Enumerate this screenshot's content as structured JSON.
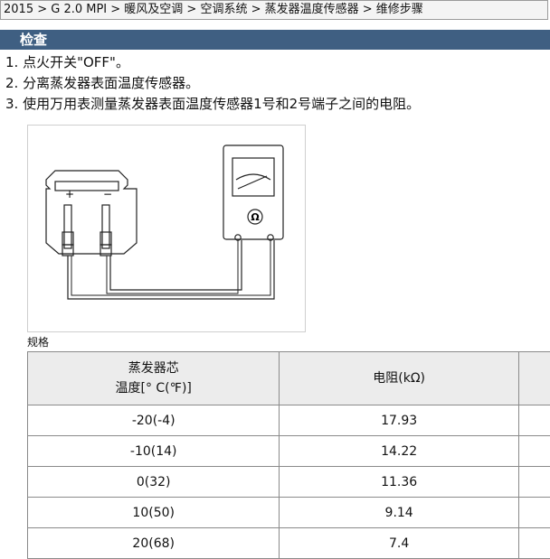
{
  "breadcrumb": "2015 > G 2.0 MPI > 暖风及空调 > 空调系统 > 蒸发器温度传感器 > 维修步骤",
  "section": {
    "title": "检查"
  },
  "steps": [
    "1. 点火开关\"OFF\"。",
    "2. 分离蒸发器表面温度传感器。",
    "3. 使用万用表测量蒸发器表面温度传感器1号和2号端子之间的电阻。"
  ],
  "diagram": {
    "plus": "+",
    "minus": "−",
    "ohm": "Ω"
  },
  "spec": {
    "label": "规格",
    "headers": [
      "蒸发器芯\n温度[° C(℉)]",
      "电阻(kΩ)",
      ""
    ],
    "rows": [
      [
        "-20(-4)",
        "17.93",
        ""
      ],
      [
        "-10(14)",
        "14.22",
        ""
      ],
      [
        "0(32)",
        "11.36",
        ""
      ],
      [
        "10(50)",
        "9.14",
        ""
      ],
      [
        "20(68)",
        "7.4",
        ""
      ]
    ]
  }
}
